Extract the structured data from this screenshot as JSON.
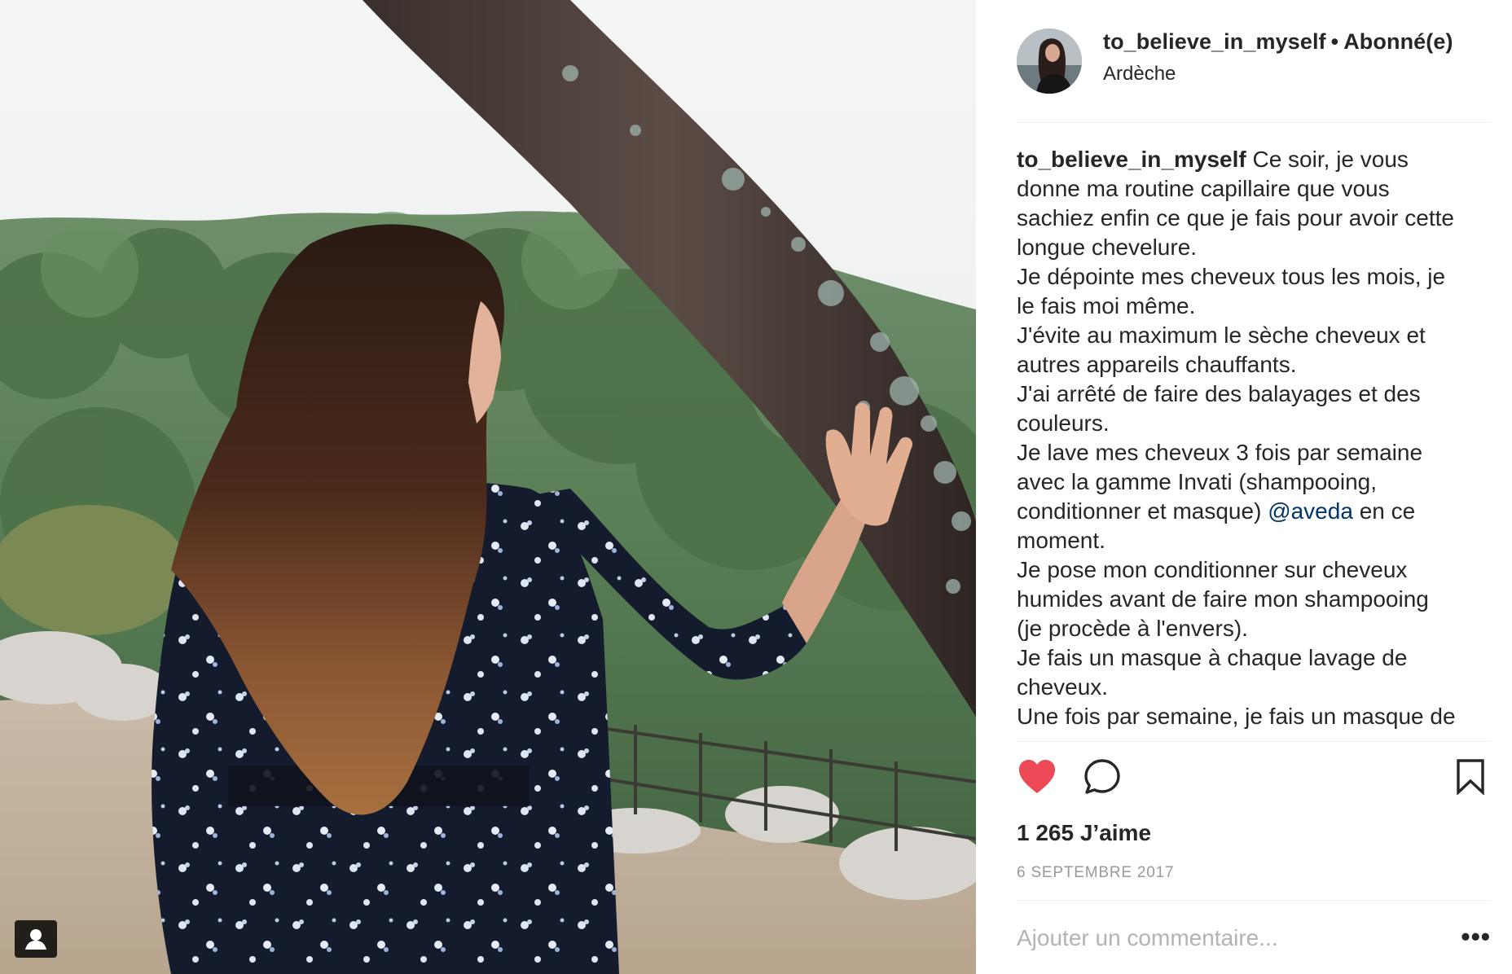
{
  "post": {
    "username": "to_believe_in_myself",
    "separator": "•",
    "follow_status": "Abonné(e)",
    "location": "Ardèche",
    "caption_username": "to_believe_in_myself",
    "caption_lines": {
      "l1": "Ce soir, je vous",
      "l2": "donne ma routine capillaire que vous",
      "l3": "sachiez enfin ce que je fais pour avoir cette",
      "l4": "longue chevelure.",
      "l5": "Je dépointe mes cheveux tous les mois, je",
      "l6": "le fais moi même.",
      "l7": "J'évite au maximum le sèche cheveux et",
      "l8": "autres appareils chauffants.",
      "l9": "J'ai arrêté de faire des balayages et des",
      "l10": "couleurs.",
      "l11": "Je lave mes cheveux 3 fois par semaine",
      "l12": "avec la gamme Invati (shampooing,",
      "l13a": "conditionner et masque)",
      "l13_mention": "@aveda",
      "l13b": "en ce",
      "l14": "moment.",
      "l15": "Je pose mon conditionner sur cheveux",
      "l16": "humides avant de faire mon shampooing",
      "l17": "(je procède à l'envers).",
      "l18": "Je fais un masque à chaque lavage de",
      "l19": "cheveux.",
      "l20": "Une fois par semaine, je fais un masque de"
    },
    "likes_text": "1 265 J’aime",
    "date_text": "6 SEPTEMBRE 2017",
    "liked": true
  },
  "comment": {
    "placeholder": "Ajouter un commentaire...",
    "more_label": "•••"
  },
  "icons": {
    "like": "heart-icon",
    "comment": "speech-bubble-icon",
    "save": "bookmark-icon",
    "tag": "user-tag-icon",
    "more": "ellipsis-icon"
  },
  "colors": {
    "like_red": "#ed4956",
    "mention_blue": "#003569",
    "muted_gray": "#999999",
    "placeholder_gray": "#b3b3b3"
  }
}
